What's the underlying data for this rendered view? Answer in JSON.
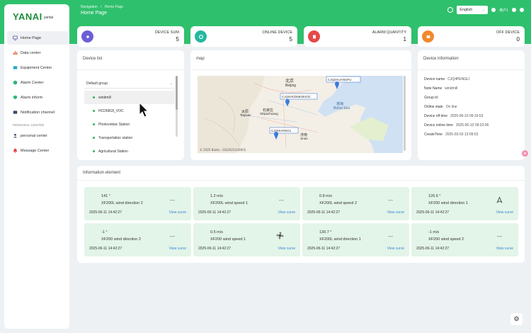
{
  "app": {
    "logo_main": "YANAI",
    "logo_sub": "yantai"
  },
  "sidebar": {
    "items": [
      {
        "label": "Home Page",
        "icon": "monitor-icon"
      },
      {
        "label": "Data center",
        "icon": "bar-chart-icon"
      },
      {
        "label": "Equipment Center",
        "icon": "equipment-icon"
      },
      {
        "label": "Alarm Center",
        "icon": "alarm-icon"
      },
      {
        "label": "Alarm inform",
        "icon": "shield-icon"
      },
      {
        "label": "Notification channel",
        "icon": "notification-icon"
      }
    ],
    "section_label": "PERSONAL CENTER",
    "personal_items": [
      {
        "label": "personal center",
        "icon": "user-icon"
      },
      {
        "label": "Message Center",
        "icon": "bell-icon"
      }
    ]
  },
  "header": {
    "breadcrumb_root": "Navigation",
    "breadcrumb_sep": "/",
    "breadcrumb_current": "Home Page",
    "title": "Home Page",
    "language": "English",
    "username": "用户1"
  },
  "stats": [
    {
      "label": "DEVICE SUM",
      "value": "5",
      "color": "#6c5fd6",
      "icon": "device-sum-icon"
    },
    {
      "label": "ONLINE DEVICE",
      "value": "5",
      "color": "#25b8a0",
      "icon": "online-icon"
    },
    {
      "label": "ALARM QUANTITY",
      "value": "1",
      "color": "#e54848",
      "icon": "alarm-quantity-icon"
    },
    {
      "label": "OFF DEVICE",
      "value": "0",
      "color": "#f08a2c",
      "icon": "off-device-icon"
    }
  ],
  "device_list": {
    "title": "Device list",
    "group": "Default group",
    "items": [
      "windmill",
      "HCD6818_VOC",
      "Photovoltaic Station",
      "Transportation station",
      "Agricultural Station"
    ]
  },
  "map": {
    "title": "map",
    "labels": {
      "beijing_cn": "北京",
      "beijing": "Beijing",
      "bohai_cn": "渤海",
      "bohai": "Bohai Sea",
      "shijiazhuang_cn": "石家庄",
      "shijiazhuang": "Shijiazhuang",
      "taiyuan_cn": "太原",
      "taiyuan": "Taiyuan",
      "jinan_cn": "济南",
      "jinan": "Jinan"
    },
    "markers": [
      "CJQ4XUANGFU",
      "CJQ4HCD6818VOC",
      "CJQHHONG1"
    ],
    "attribution": "© 2025 Baidu - GS(2023)3206号"
  },
  "device_info": {
    "title": "Device information",
    "rows": [
      {
        "key": "Device name",
        "value": "CJQ4PENGLI"
      },
      {
        "key": "Note Name",
        "value": "windmill"
      },
      {
        "key": "Group id",
        "value": ""
      },
      {
        "key": "Online state",
        "value": "On line"
      },
      {
        "key": "Device off time",
        "value": "2025-06-10 09:19:53"
      },
      {
        "key": "Device online time",
        "value": "2025-06-10 09:23:06"
      },
      {
        "key": "CreateTime",
        "value": "2025-03-03 13:09:53"
      }
    ]
  },
  "info_elements": {
    "title": "Information element",
    "cards": [
      {
        "value": "141 °",
        "name": "XF200L wind direction 2",
        "dash": "---",
        "time": "2025-06-11 14:42:27",
        "link": "View curve",
        "icon": ""
      },
      {
        "value": "1.2 m/s",
        "name": "XF200L wind speed 1",
        "dash": "---",
        "time": "2025-06-11 14:42:27",
        "link": "View curve",
        "icon": ""
      },
      {
        "value": "0.8 m/s",
        "name": "XF200L wind speed 2",
        "dash": "---",
        "time": "2025-06-11 14:42:27",
        "link": "View curve",
        "icon": ""
      },
      {
        "value": "126.6 °",
        "name": "XF200 wind direction 1",
        "dash": "",
        "time": "2025-06-11 14:42:27",
        "link": "View curve",
        "icon": "wind-direction-icon"
      },
      {
        "value": "-1 °",
        "name": "XF200 wind direction 2",
        "dash": "---",
        "time": "2025-06-11 14:42:27",
        "link": "View curve",
        "icon": ""
      },
      {
        "value": "0.5 m/s",
        "name": "XF200 wind speed 1",
        "dash": "",
        "time": "2025-06-11 14:42:27",
        "link": "View curve",
        "icon": "fan-icon"
      },
      {
        "value": "130.7 °",
        "name": "XF200L wind direction 1",
        "dash": "---",
        "time": "2025-06-11 14:42:27",
        "link": "View curve",
        "icon": ""
      },
      {
        "value": "-1 m/s",
        "name": "XF200 wind speed 2",
        "dash": "---",
        "time": "2025-06-11 14:42:27",
        "link": "View curve",
        "icon": ""
      }
    ]
  }
}
